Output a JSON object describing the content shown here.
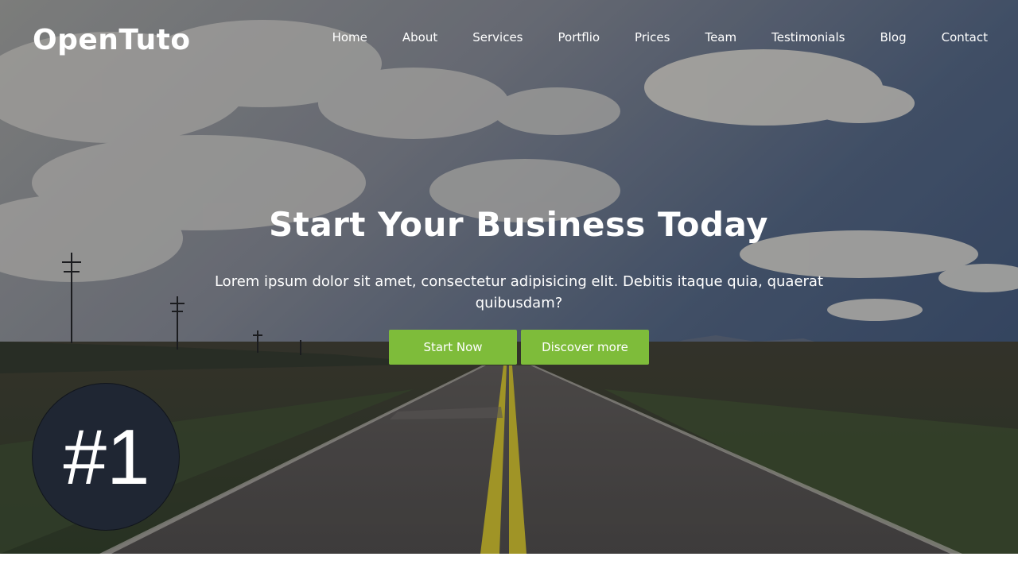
{
  "brand": {
    "logo": "OpenTuto"
  },
  "nav": {
    "items": [
      {
        "label": "Home"
      },
      {
        "label": "About"
      },
      {
        "label": "Services"
      },
      {
        "label": "Portflio"
      },
      {
        "label": "Prices"
      },
      {
        "label": "Team"
      },
      {
        "label": "Testimonials"
      },
      {
        "label": "Blog"
      },
      {
        "label": "Contact"
      }
    ]
  },
  "hero": {
    "title": "Start Your Business Today",
    "subtitle": "Lorem ipsum dolor sit amet, consectetur adipisicing elit. Debitis itaque quia, quaerat quibusdam?",
    "primary_button": "Start Now",
    "secondary_button": "Discover more",
    "background_image": "road-landscape-sky"
  },
  "episode_badge": {
    "label": "#1"
  },
  "colors": {
    "accent": "#7ebc3a",
    "text": "#ffffff",
    "badge": "#1f2633"
  }
}
